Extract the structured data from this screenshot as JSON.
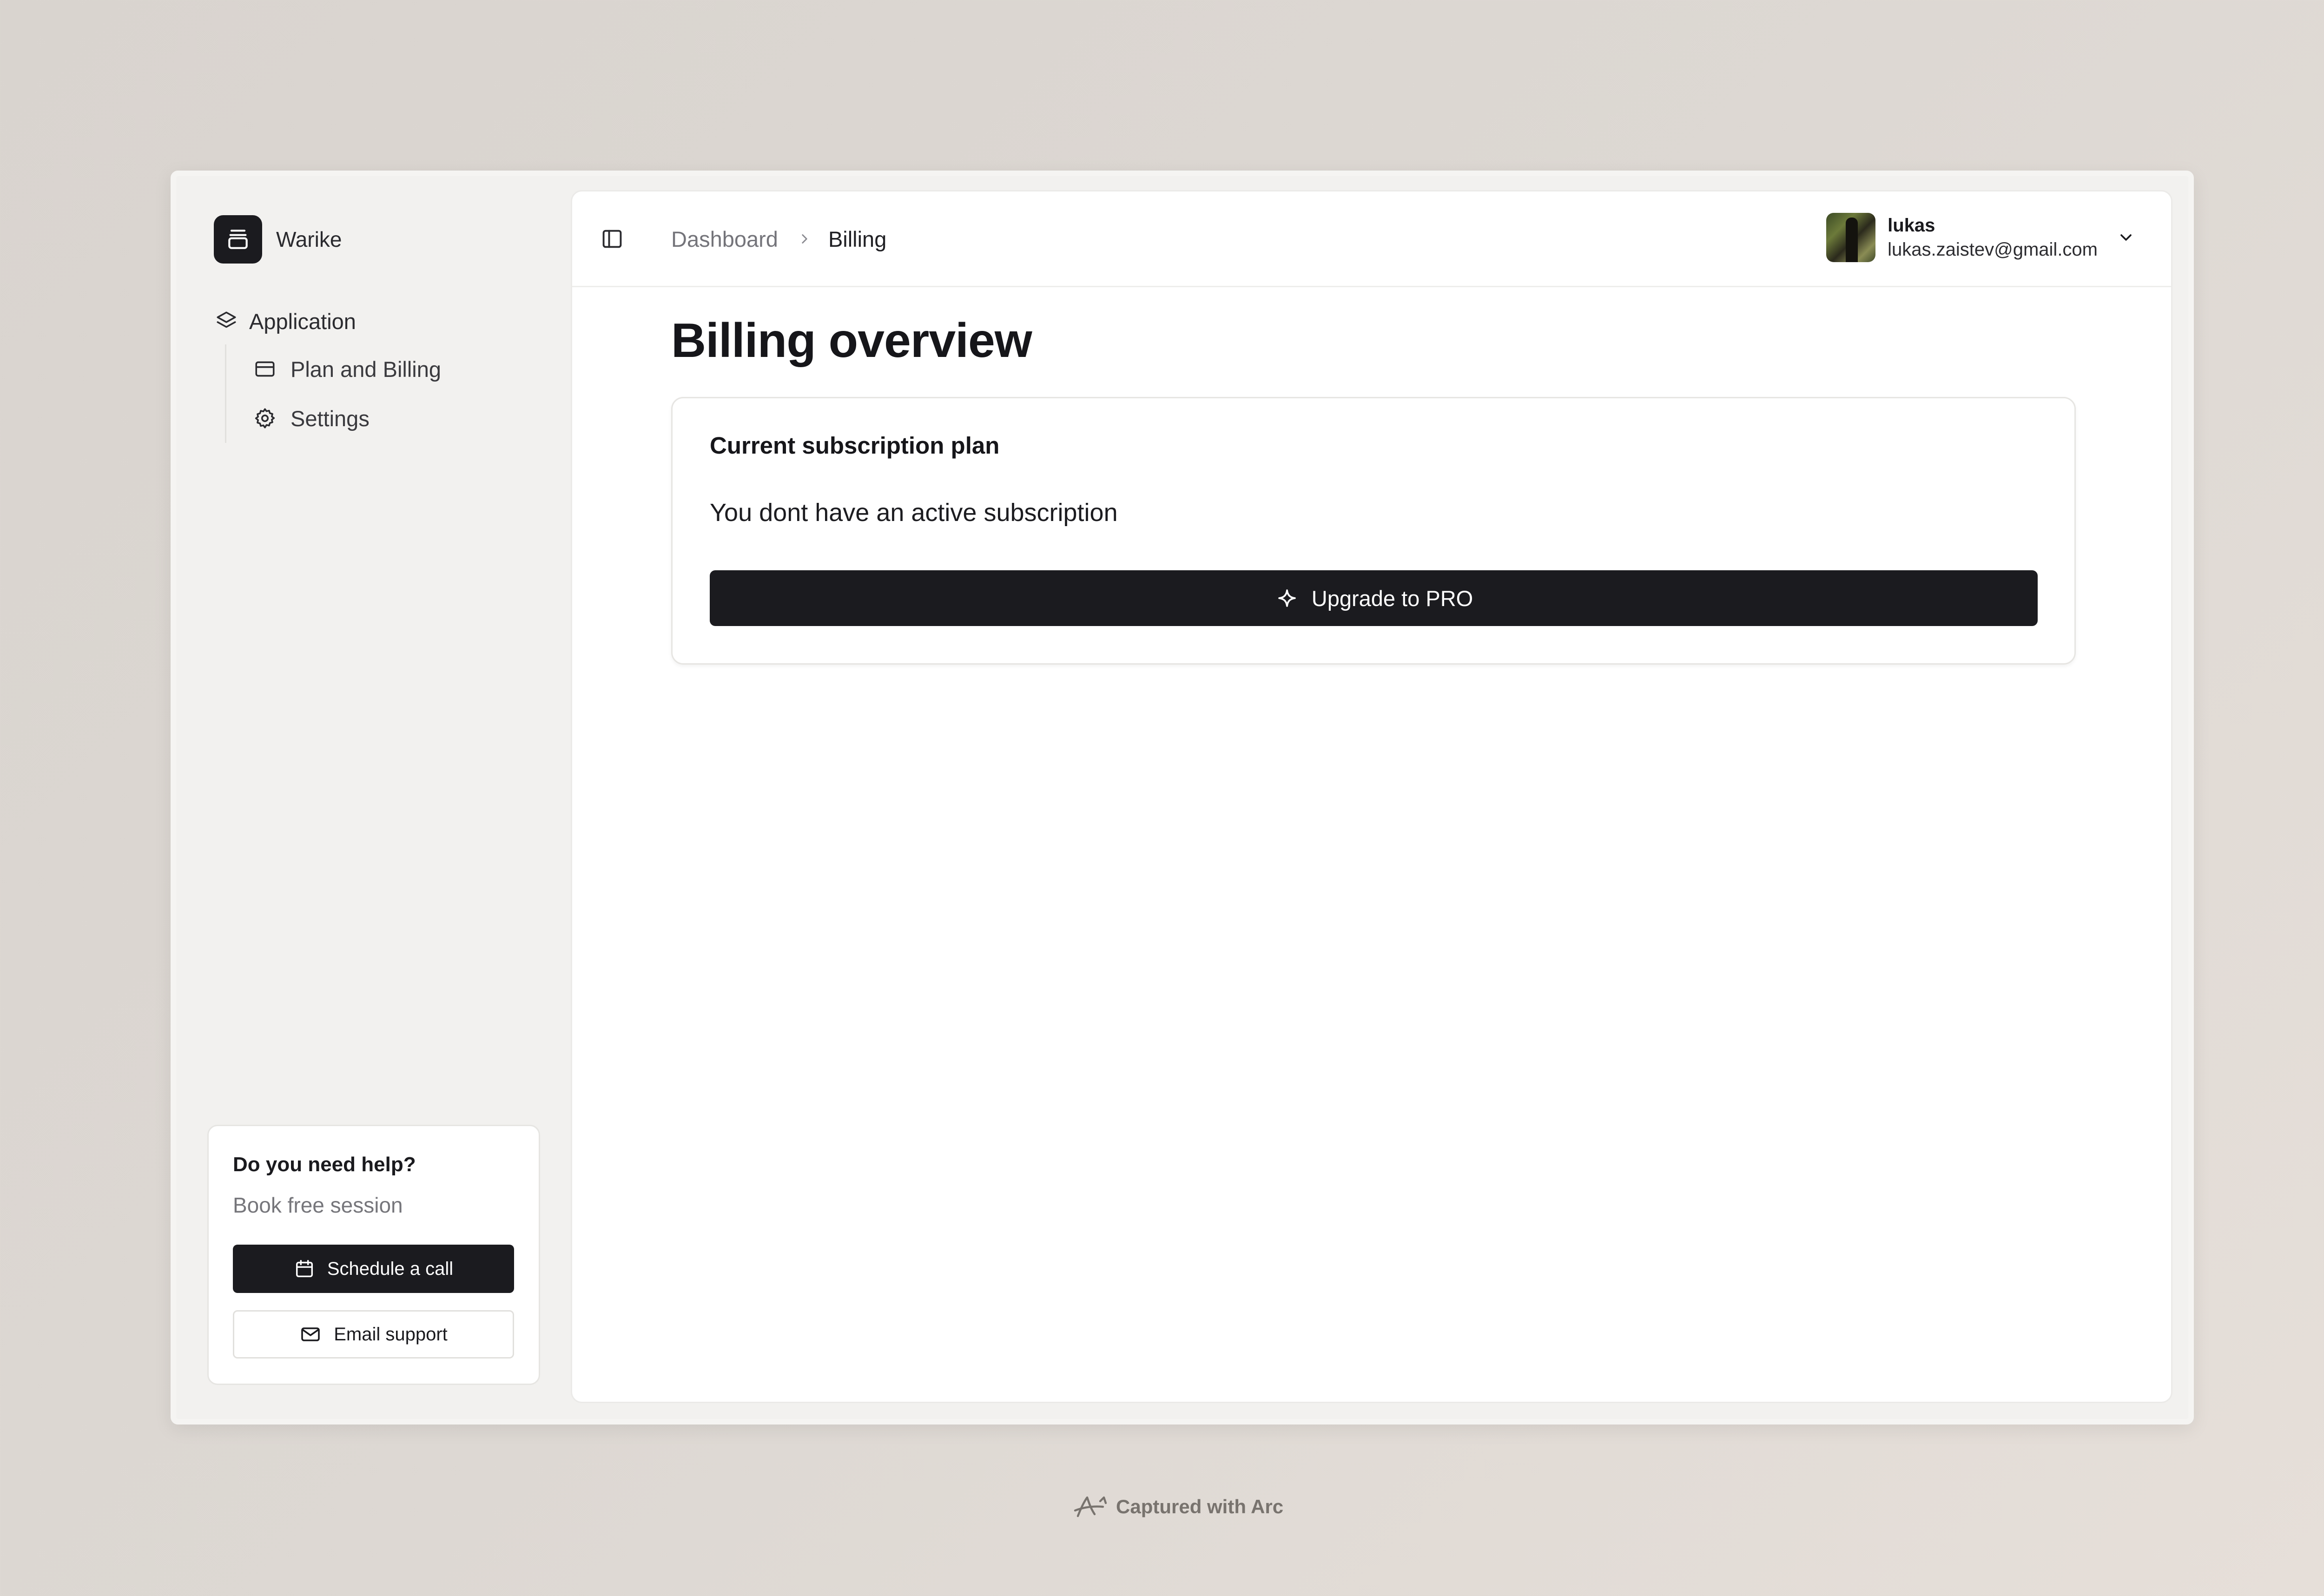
{
  "brand": {
    "name": "Warike",
    "logo_icon": "archive-box-icon"
  },
  "sidebar": {
    "group": {
      "label": "Application",
      "icon": "layers-icon"
    },
    "items": [
      {
        "label": "Plan and Billing",
        "icon": "credit-card-icon",
        "active": true
      },
      {
        "label": "Settings",
        "icon": "gear-icon",
        "active": false
      }
    ]
  },
  "help": {
    "title": "Do you need help?",
    "subtitle": "Book free session",
    "schedule_label": "Schedule a call",
    "schedule_icon": "calendar-icon",
    "email_label": "Email support",
    "email_icon": "mail-icon"
  },
  "header": {
    "breadcrumb": [
      "Dashboard",
      "Billing"
    ],
    "toggle_icon": "sidebar-toggle-icon",
    "user": {
      "name": "lukas",
      "email": "lukas.zaistev@gmail.com"
    }
  },
  "main": {
    "title": "Billing overview",
    "plan_card": {
      "title": "Current subscription plan",
      "message": "You dont have an active subscription",
      "button_label": "Upgrade to PRO",
      "button_icon": "sparkle-icon"
    }
  },
  "footer": {
    "text": "Captured with Arc"
  },
  "colors": {
    "primary": "#1b1b1f",
    "background": "#ddd8d3",
    "surface": "#ffffff",
    "muted_text": "#74747a"
  }
}
